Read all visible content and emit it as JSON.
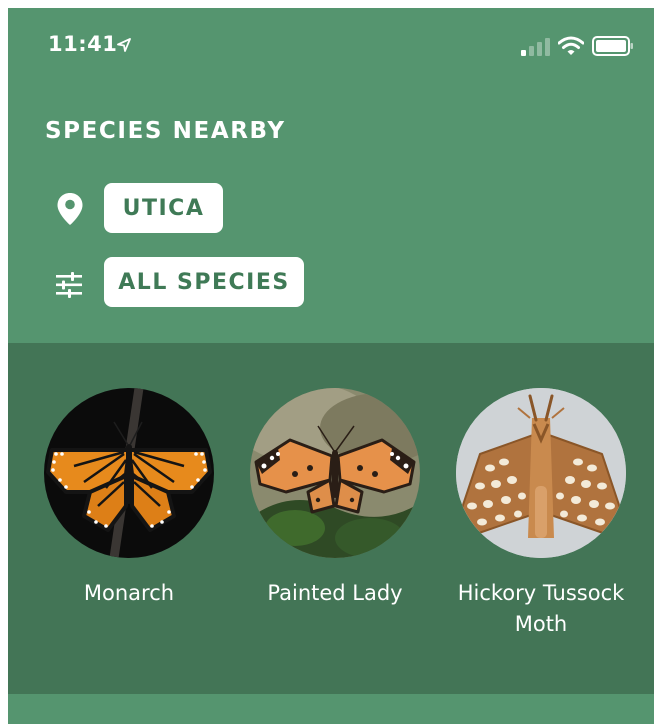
{
  "status_bar": {
    "time": "11:41"
  },
  "header": {
    "title": "SPECIES NEARBY",
    "location_chip": "UTICA",
    "filter_chip": "ALL SPECIES"
  },
  "species": [
    {
      "name": "Monarch"
    },
    {
      "name": "Painted Lady"
    },
    {
      "name": "Hickory Tussock Moth"
    }
  ],
  "colors": {
    "header_green": "#55956f",
    "strip_green": "#437556",
    "chip_text": "#3f7a56"
  },
  "icons": [
    "location-arrow-icon",
    "signal-icon",
    "wifi-icon",
    "battery-icon",
    "location-pin-icon",
    "filter-sliders-icon"
  ]
}
